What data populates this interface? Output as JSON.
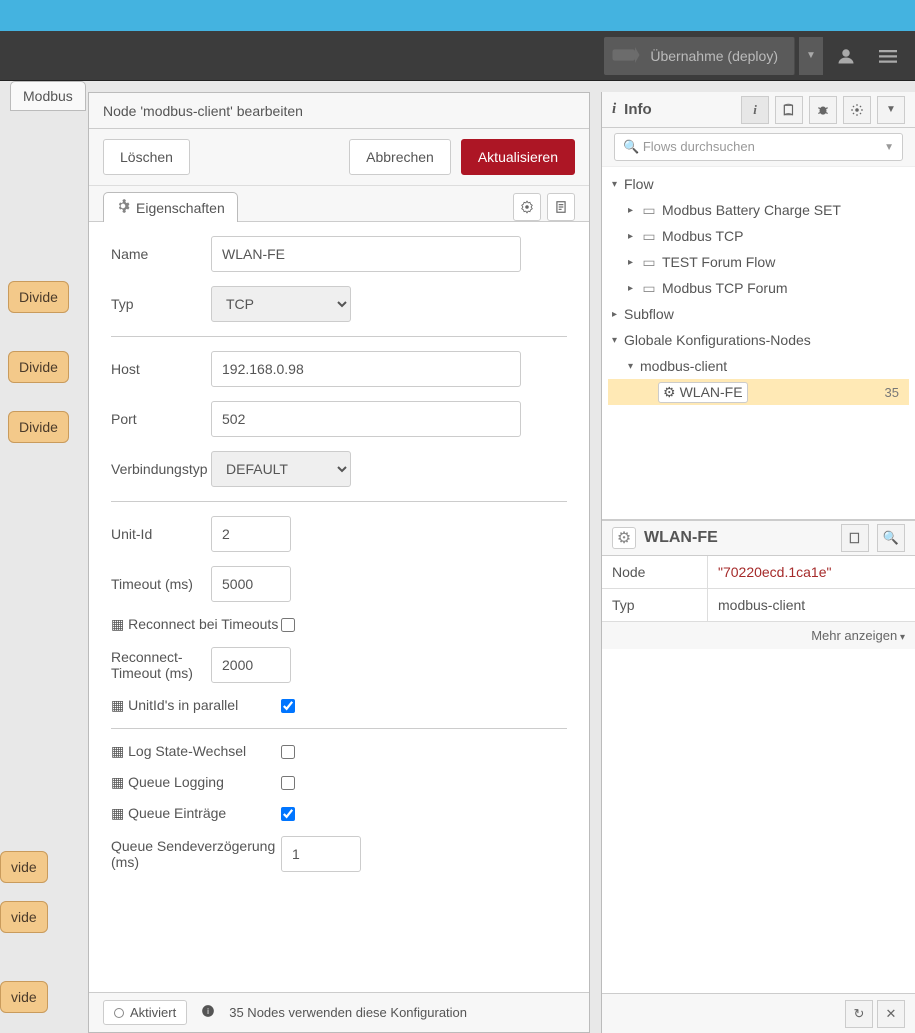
{
  "header": {
    "deploy_label": "Übernahme (deploy)"
  },
  "editor": {
    "title": "Node 'modbus-client' bearbeiten",
    "delete_label": "Löschen",
    "cancel_label": "Abbrechen",
    "update_label": "Aktualisieren",
    "properties_tab": "Eigenschaften"
  },
  "form": {
    "name_label": "Name",
    "name_value": "WLAN-FE",
    "type_label": "Typ",
    "type_value": "TCP",
    "host_label": "Host",
    "host_value": "192.168.0.98",
    "port_label": "Port",
    "port_value": "502",
    "conn_label": "Verbindungstyp",
    "conn_value": "DEFAULT",
    "unitid_label": "Unit-Id",
    "unitid_value": "2",
    "timeout_label": "Timeout (ms)",
    "timeout_value": "5000",
    "reconnect_label": "Reconnect bei Timeouts",
    "reconnect_checked": false,
    "reconnect_timeout_label": "Reconnect-Timeout (ms)",
    "reconnect_timeout_value": "2000",
    "parallel_label": "UnitId's in parallel",
    "parallel_checked": true,
    "logstate_label": "Log State-Wechsel",
    "logstate_checked": false,
    "queuelog_label": "Queue Logging",
    "queuelog_checked": false,
    "queueentries_label": "Queue Einträge",
    "queueentries_checked": true,
    "queuedelay_label": "Queue Sendeverzögerung (ms)",
    "queuedelay_value": "1",
    "enabled_label": "Aktiviert",
    "usage_text": "35 Nodes verwenden diese Konfiguration"
  },
  "right": {
    "info_title": "Info",
    "search_placeholder": "Flows durchsuchen",
    "tree": {
      "flow_label": "Flow",
      "flows": [
        "Modbus Battery Charge SET",
        "Modbus TCP",
        "TEST Forum Flow",
        "Modbus TCP Forum"
      ],
      "subflow_label": "Subflow",
      "global_label": "Globale Konfigurations-Nodes",
      "modbus_client": "modbus-client",
      "wlanfe": "WLAN-FE",
      "wlanfe_count": "35"
    },
    "detail": {
      "title": "WLAN-FE",
      "node_label": "Node",
      "node_id": "\"70220ecd.1ca1e\"",
      "type_label": "Typ",
      "type_value": "modbus-client",
      "more": "Mehr anzeigen"
    }
  },
  "tabs": {
    "modbus": "Modbus",
    "divide": "Divide",
    "vide": "vide"
  }
}
